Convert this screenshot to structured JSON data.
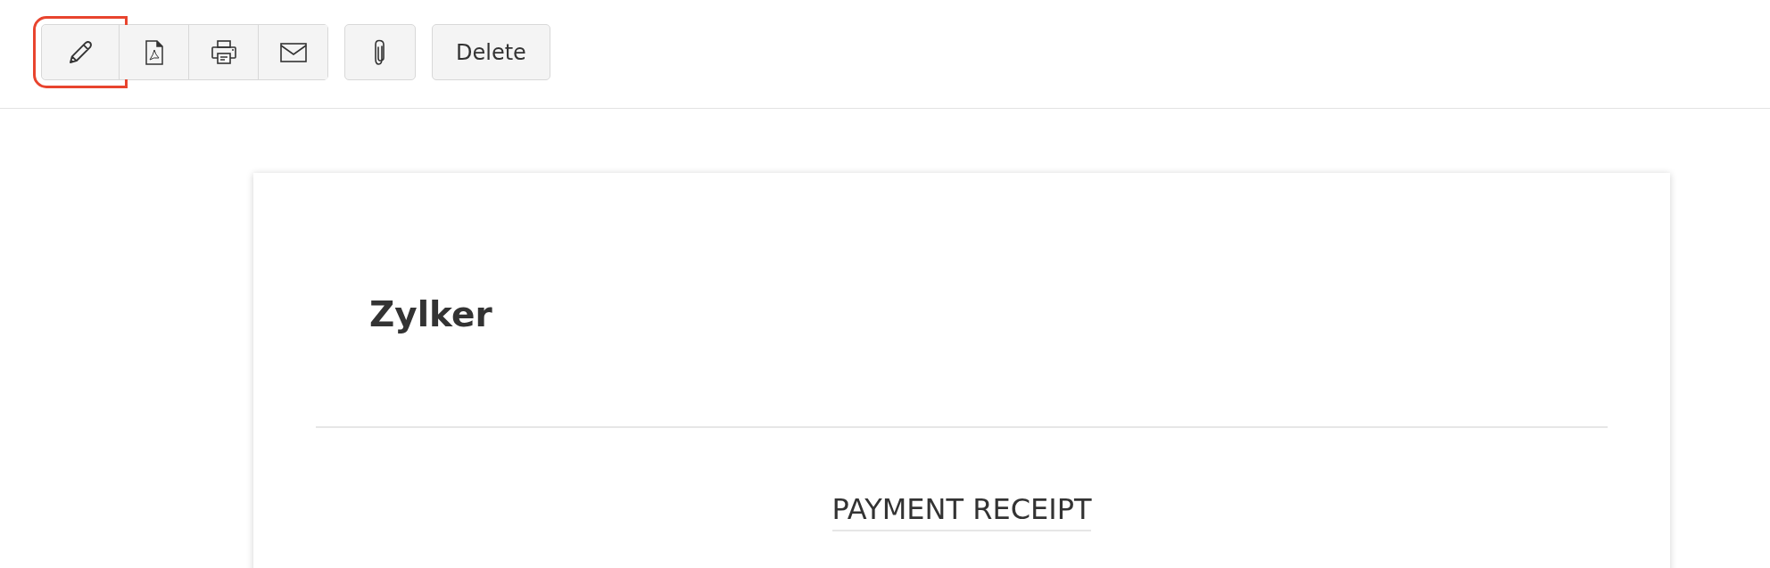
{
  "toolbar": {
    "icon_group": [
      {
        "kind": "edit",
        "highlighted": true
      },
      {
        "kind": "pdf",
        "highlighted": false
      },
      {
        "kind": "print",
        "highlighted": false
      },
      {
        "kind": "mail",
        "highlighted": false
      }
    ],
    "attach_button": {
      "kind": "attach"
    },
    "delete_button": {
      "label": "Delete"
    }
  },
  "receipt": {
    "company": "Zylker",
    "title": "PAYMENT RECEIPT"
  }
}
